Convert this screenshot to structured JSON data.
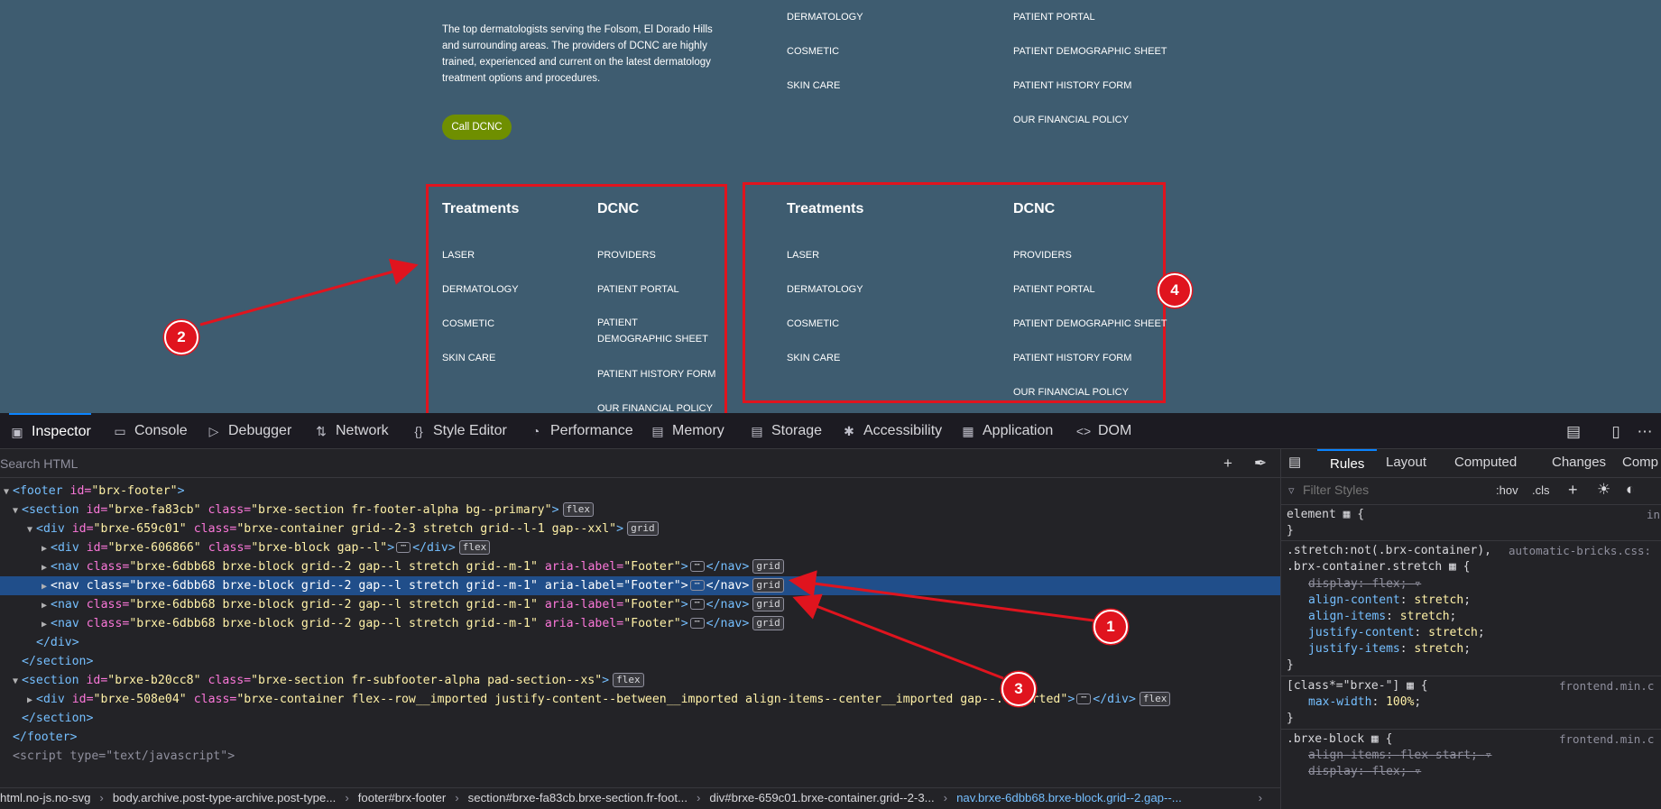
{
  "preview": {
    "about_text": "The top dermatologists serving the Folsom, El Dorado Hills and surrounding areas. The providers of DCNC are highly trained, experienced and current on the latest dermatology treatment options and procedures.",
    "call_button": "Call DCNC",
    "top_col1": [
      "DERMATOLOGY",
      "COSMETIC",
      "SKIN CARE"
    ],
    "top_col2": [
      "PATIENT PORTAL",
      "PATIENT DEMOGRAPHIC SHEET",
      "PATIENT HISTORY FORM",
      "OUR FINANCIAL POLICY"
    ],
    "box_left": {
      "treatments_heading": "Treatments",
      "treatments": [
        "LASER",
        "DERMATOLOGY",
        "COSMETIC",
        "SKIN CARE"
      ],
      "dcnc_heading": "DCNC",
      "dcnc": [
        "PROVIDERS",
        "PATIENT PORTAL",
        "PATIENT DEMOGRAPHIC SHEET",
        "PATIENT HISTORY FORM",
        "OUR FINANCIAL POLICY"
      ]
    },
    "box_right": {
      "treatments_heading": "Treatments",
      "treatments": [
        "LASER",
        "DERMATOLOGY",
        "COSMETIC",
        "SKIN CARE"
      ],
      "dcnc_heading": "DCNC",
      "dcnc": [
        "PROVIDERS",
        "PATIENT PORTAL",
        "PATIENT DEMOGRAPHIC SHEET",
        "PATIENT HISTORY FORM",
        "OUR FINANCIAL POLICY"
      ]
    }
  },
  "annotations": {
    "badge1": "1",
    "badge2": "2",
    "badge3": "3",
    "badge4": "4",
    "color": "#e0141e"
  },
  "devtools": {
    "tabs": [
      "Inspector",
      "Console",
      "Debugger",
      "Network",
      "Style Editor",
      "Performance",
      "Memory",
      "Storage",
      "Accessibility",
      "Application",
      "DOM"
    ],
    "tab_icons": [
      "inspector-icon",
      "console-icon",
      "debugger-icon",
      "network-icon",
      "style-editor-icon",
      "performance-icon",
      "memory-icon",
      "storage-icon",
      "accessibility-icon",
      "application-icon",
      "dom-icon"
    ],
    "active_tab": "Inspector",
    "search_placeholder": "Search HTML",
    "html_lines": [
      {
        "open": "<footer",
        "attrs": [
          [
            "id",
            "brx-footer"
          ]
        ],
        "close": ">",
        "tail": "",
        "pill": ""
      },
      {
        "open": "<section",
        "attrs": [
          [
            "id",
            "brxe-fa83cb"
          ],
          [
            "class",
            "brxe-section fr-footer-alpha bg--primary"
          ]
        ],
        "close": ">",
        "tail": "",
        "pill": "flex"
      },
      {
        "open": "<div",
        "attrs": [
          [
            "id",
            "brxe-659c01"
          ],
          [
            "class",
            "brxe-container grid--2-3 stretch grid--l-1 gap--xxl"
          ]
        ],
        "close": ">",
        "tail": "",
        "pill": "grid"
      },
      {
        "open": "<div",
        "attrs": [
          [
            "id",
            "brxe-606866"
          ],
          [
            "class",
            "brxe-block gap--l"
          ]
        ],
        "close": ">",
        "tail": "</div>",
        "pill": "flex"
      },
      {
        "open": "<nav",
        "attrs": [
          [
            "class",
            "brxe-6dbb68 brxe-block grid--2 gap--l stretch grid--m-1"
          ],
          [
            "aria-label",
            "Footer"
          ]
        ],
        "close": ">",
        "tail": "</nav>",
        "pill": "grid"
      },
      {
        "open": "<nav",
        "attrs": [
          [
            "class",
            "brxe-6dbb68 brxe-block grid--2 gap--l stretch grid--m-1"
          ],
          [
            "aria-label",
            "Footer"
          ]
        ],
        "close": ">",
        "tail": "</nav>",
        "pill": "grid"
      },
      {
        "open": "<nav",
        "attrs": [
          [
            "class",
            "brxe-6dbb68 brxe-block grid--2 gap--l stretch grid--m-1"
          ],
          [
            "aria-label",
            "Footer"
          ]
        ],
        "close": ">",
        "tail": "</nav>",
        "pill": "grid"
      },
      {
        "open": "<nav",
        "attrs": [
          [
            "class",
            "brxe-6dbb68 brxe-block grid--2 gap--l stretch grid--m-1"
          ],
          [
            "aria-label",
            "Footer"
          ]
        ],
        "close": ">",
        "tail": "</nav>",
        "pill": "grid"
      },
      {
        "open": "</div>",
        "attrs": [],
        "close": "",
        "tail": "",
        "pill": ""
      },
      {
        "open": "</section>",
        "attrs": [],
        "close": "",
        "tail": "",
        "pill": ""
      },
      {
        "open": "<section",
        "attrs": [
          [
            "id",
            "brxe-b20cc8"
          ],
          [
            "class",
            "brxe-section fr-subfooter-alpha pad-section--xs"
          ]
        ],
        "close": ">",
        "tail": "",
        "pill": "flex"
      },
      {
        "open": "<div",
        "attrs": [
          [
            "id",
            "brxe-508e04"
          ],
          [
            "class",
            "brxe-container flex--row__imported justify-content--between__imported align-items--center__imported gap--...ported"
          ]
        ],
        "close": ">",
        "tail": "</div>",
        "pill": "flex"
      },
      {
        "open": "</section>",
        "attrs": [],
        "close": "",
        "tail": "",
        "pill": ""
      },
      {
        "open": "</footer>",
        "attrs": [],
        "close": "",
        "tail": "",
        "pill": ""
      },
      {
        "open": "<script",
        "attrs": [
          [
            "type",
            "text/javascript"
          ]
        ],
        "close": ">",
        "tail": "",
        "pill": ""
      }
    ],
    "breadcrumbs": [
      "html.no-js.no-svg",
      "body.archive.post-type-archive.post-type...",
      "footer#brx-footer",
      "section#brxe-fa83cb.brxe-section.fr-foot...",
      "div#brxe-659c01.brxe-container.grid--2-3...",
      "nav.brxe-6dbb68.brxe-block.grid--2.gap--..."
    ],
    "side_tabs": [
      "Rules",
      "Layout",
      "Computed",
      "Changes",
      "Comp"
    ],
    "filter_placeholder": "Filter Styles",
    "hov": ":hov",
    "cls": ".cls",
    "rules": {
      "r1_selector": "element",
      "r1_source": "in",
      "r2_selector_a": ".stretch:not(.brx-container),",
      "r2_selector_b": ".brx-container.stretch",
      "r2_source": "automatic-bricks.css:",
      "r2_decls": [
        [
          "display",
          "flex"
        ],
        [
          "align-content",
          "stretch"
        ],
        [
          "align-items",
          "stretch"
        ],
        [
          "justify-content",
          "stretch"
        ],
        [
          "justify-items",
          "stretch"
        ]
      ],
      "r3_selector": "[class*=\"brxe-\"]",
      "r3_source": "frontend.min.c",
      "r3_decls": [
        [
          "max-width",
          "100%"
        ]
      ],
      "r4_selector": ".brxe-block",
      "r4_source": "frontend.min.c",
      "r4_decls": [
        [
          "align-items",
          "flex-start"
        ],
        [
          "display",
          "flex"
        ]
      ]
    }
  }
}
